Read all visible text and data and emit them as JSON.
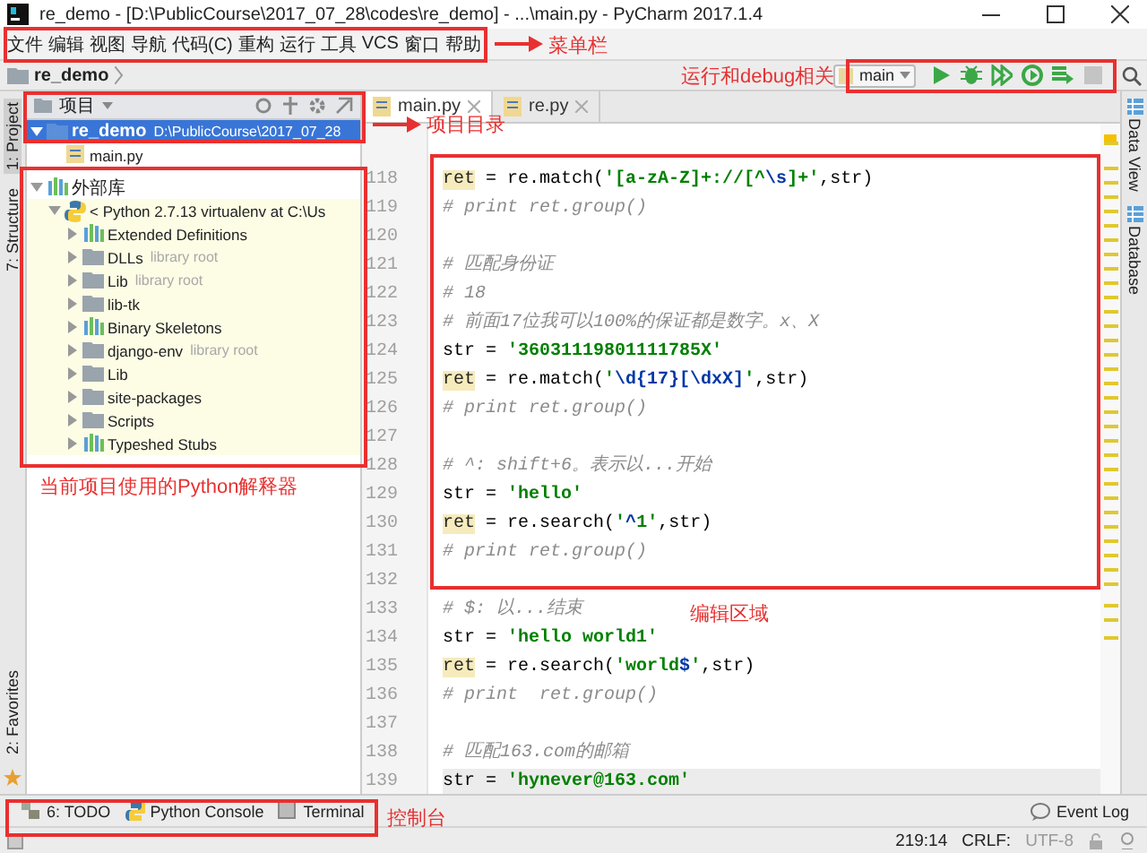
{
  "window": {
    "title": "re_demo - [D:\\PublicCourse\\2017_07_28\\codes\\re_demo] - ...\\main.py - PyCharm 2017.1.4"
  },
  "menu": [
    "文件",
    "编辑",
    "视图",
    "导航",
    "代码(C)",
    "重构",
    "运行",
    "工具",
    "VCS",
    "窗口",
    "帮助"
  ],
  "nav_bar": {
    "breadcrumb": "re_demo",
    "run_config": "main",
    "actions": [
      {
        "kind": "run",
        "disabled": false
      },
      {
        "kind": "debug",
        "disabled": false
      },
      {
        "kind": "coverage",
        "disabled": false
      },
      {
        "kind": "profile",
        "disabled": false
      },
      {
        "kind": "concurrency",
        "disabled": false
      },
      {
        "kind": "stop",
        "disabled": true
      }
    ]
  },
  "left_strip": [
    {
      "label": "1: Project",
      "selected": true
    },
    {
      "label": "7: Structure",
      "selected": false
    },
    {
      "label": "2: Favorites",
      "selected": false
    }
  ],
  "right_strip": [
    "Data View",
    "Database"
  ],
  "project_panel": {
    "title": "项目",
    "tree": [
      {
        "label": "re_demo",
        "hint": "D:\\PublicCourse\\2017_07_28",
        "kind": "module",
        "expanded": true,
        "selected": true,
        "children": [
          {
            "label": "main.py",
            "kind": "file",
            "selected": false
          }
        ]
      },
      {
        "label": "外部库",
        "kind": "library",
        "expanded": true,
        "selected": false,
        "children": [
          {
            "label": "< Python 2.7.13 virtualenv at C:\\Us",
            "kind": "python",
            "expanded": true,
            "selected": false,
            "children": [
              {
                "label": "Extended Definitions",
                "kind": "library",
                "expanded": false,
                "selected": false
              },
              {
                "label": "DLLs",
                "hint": "library root",
                "kind": "folder",
                "expanded": false,
                "selected": false
              },
              {
                "label": "Lib",
                "hint": "library root",
                "kind": "folder",
                "expanded": false,
                "selected": false
              },
              {
                "label": "lib-tk",
                "kind": "folder",
                "expanded": false,
                "selected": false
              },
              {
                "label": "Binary Skeletons",
                "kind": "library",
                "expanded": false,
                "selected": false
              },
              {
                "label": "django-env",
                "hint": "library root",
                "kind": "folder",
                "expanded": false,
                "selected": false
              },
              {
                "label": "Lib",
                "kind": "folder",
                "expanded": false,
                "selected": false
              },
              {
                "label": "site-packages",
                "kind": "folder",
                "expanded": false,
                "selected": false
              },
              {
                "label": "Scripts",
                "kind": "folder",
                "expanded": false,
                "selected": false
              },
              {
                "label": "Typeshed Stubs",
                "kind": "library",
                "expanded": false,
                "selected": false
              }
            ]
          }
        ]
      }
    ]
  },
  "editor": {
    "tabs": [
      {
        "label": "main.py",
        "selected": true
      },
      {
        "label": "re.py",
        "selected": false
      }
    ],
    "lines": [
      {
        "number": "118",
        "tokens": [
          {
            "kind": "var",
            "text": "ret"
          },
          {
            "kind": "code",
            "text": " = re.match("
          },
          {
            "kind": "string",
            "text": "'[a-zA-Z]+://[^"
          },
          {
            "kind": "escape",
            "text": "\\s"
          },
          {
            "kind": "string",
            "text": "]+'"
          },
          {
            "kind": "code",
            "text": ",str)"
          }
        ]
      },
      {
        "number": "119",
        "tokens": [
          {
            "kind": "comment",
            "text": "# print ret.group()"
          }
        ]
      },
      {
        "number": "120"
      },
      {
        "number": "121",
        "tokens": [
          {
            "kind": "comment",
            "text": "# 匹配身份证"
          }
        ]
      },
      {
        "number": "122",
        "tokens": [
          {
            "kind": "comment",
            "text": "# 18"
          }
        ]
      },
      {
        "number": "123",
        "tokens": [
          {
            "kind": "comment",
            "text": "# 前面17位我可以100%的保证都是数字。x、X"
          }
        ]
      },
      {
        "number": "124",
        "tokens": [
          {
            "kind": "code",
            "text": "str = "
          },
          {
            "kind": "string",
            "text": "'36031119801111785X'"
          }
        ]
      },
      {
        "number": "125",
        "tokens": [
          {
            "kind": "var",
            "text": "ret"
          },
          {
            "kind": "code",
            "text": " = re.match("
          },
          {
            "kind": "string",
            "text": "'"
          },
          {
            "kind": "escape",
            "text": "\\d{17}[\\dxX]"
          },
          {
            "kind": "string",
            "text": "'"
          },
          {
            "kind": "code",
            "text": ",str)"
          }
        ]
      },
      {
        "number": "126",
        "tokens": [
          {
            "kind": "comment",
            "text": "# print ret.group()"
          }
        ]
      },
      {
        "number": "127"
      },
      {
        "number": "128",
        "tokens": [
          {
            "kind": "comment",
            "text": "# ^: shift+6。表示以...开始"
          }
        ]
      },
      {
        "number": "129",
        "tokens": [
          {
            "kind": "code",
            "text": "str = "
          },
          {
            "kind": "string",
            "text": "'hello'"
          }
        ]
      },
      {
        "number": "130",
        "tokens": [
          {
            "kind": "var",
            "text": "ret"
          },
          {
            "kind": "code",
            "text": " = re.search("
          },
          {
            "kind": "string",
            "text": "'"
          },
          {
            "kind": "escape",
            "text": "^"
          },
          {
            "kind": "string",
            "text": "1'"
          },
          {
            "kind": "code",
            "text": ",str)"
          }
        ]
      },
      {
        "number": "131",
        "tokens": [
          {
            "kind": "comment",
            "text": "# print ret.group()"
          }
        ]
      },
      {
        "number": "132"
      },
      {
        "number": "133",
        "tokens": [
          {
            "kind": "comment",
            "text": "# $: 以...结束"
          }
        ]
      },
      {
        "number": "134",
        "tokens": [
          {
            "kind": "code",
            "text": "str = "
          },
          {
            "kind": "string",
            "text": "'hello world1'"
          }
        ]
      },
      {
        "number": "135",
        "tokens": [
          {
            "kind": "var",
            "text": "ret"
          },
          {
            "kind": "code",
            "text": " = re.search("
          },
          {
            "kind": "string",
            "text": "'world"
          },
          {
            "kind": "escape",
            "text": "$"
          },
          {
            "kind": "string",
            "text": "'"
          },
          {
            "kind": "code",
            "text": ",str)"
          }
        ]
      },
      {
        "number": "136",
        "tokens": [
          {
            "kind": "comment",
            "text": "# print  ret.group()"
          }
        ]
      },
      {
        "number": "137"
      },
      {
        "number": "138",
        "tokens": [
          {
            "kind": "comment",
            "text": "# 匹配163.com的邮箱"
          }
        ]
      },
      {
        "number": "139",
        "tokens": [
          {
            "kind": "code",
            "text": "str = "
          },
          {
            "kind": "string",
            "text": "'hynever@163.com'"
          }
        ]
      }
    ]
  },
  "tool_windows": [
    {
      "label": "6: TODO",
      "kind": "todo"
    },
    {
      "label": "Python Console",
      "kind": "python"
    },
    {
      "label": "Terminal",
      "kind": "terminal"
    }
  ],
  "event_log": "Event Log",
  "status_bar": {
    "position": "219:14",
    "line_separator": "CRLF:",
    "encoding": "UTF-8"
  },
  "annotations": [
    {
      "kind": "menu",
      "label": "菜单栏",
      "arrow": true
    },
    {
      "kind": "run",
      "label": "运行和debug相关",
      "arrow": false
    },
    {
      "kind": "project",
      "label": "项目目录",
      "arrow": true
    },
    {
      "kind": "interpreter",
      "label": "当前项目使用的Python解释器",
      "arrow": false
    },
    {
      "kind": "editor",
      "label": "编辑区域",
      "arrow": false
    },
    {
      "kind": "console",
      "label": "控制台",
      "arrow": false
    }
  ]
}
